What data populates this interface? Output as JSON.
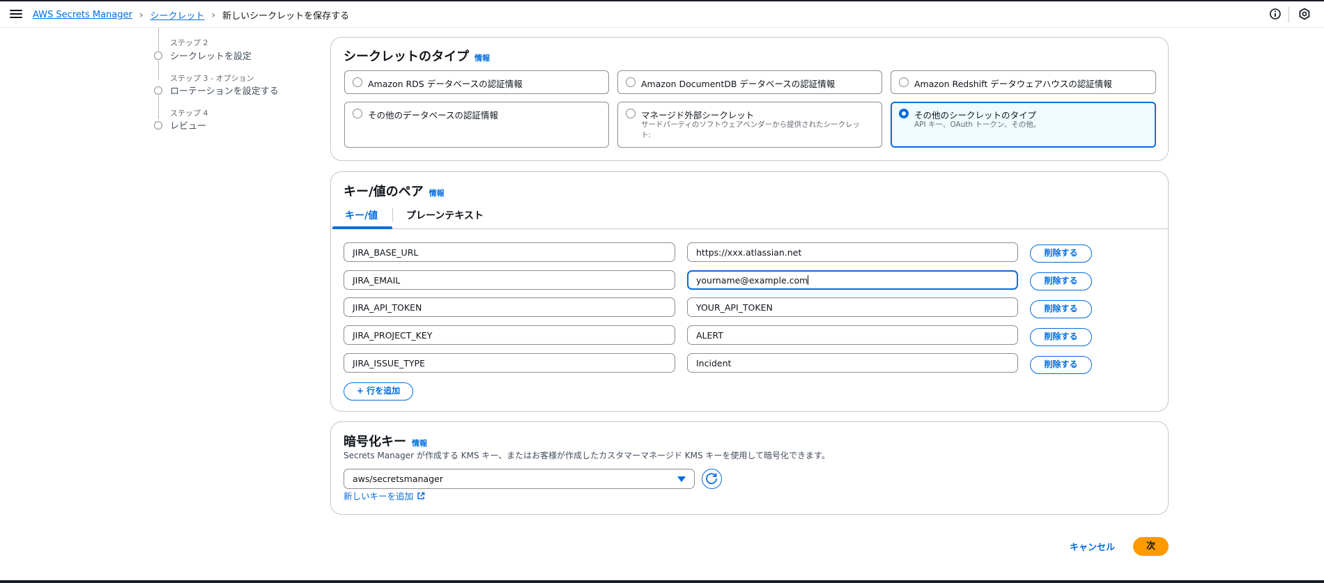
{
  "breadcrumb": {
    "service": "AWS Secrets Manager",
    "secrets": "シークレット",
    "current": "新しいシークレットを保存する"
  },
  "steps": [
    {
      "sub": "ステップ 2",
      "title": "シークレットを設定"
    },
    {
      "sub": "ステップ 3 - オプション",
      "title": "ローテーションを設定する"
    },
    {
      "sub": "ステップ 4",
      "title": "レビュー"
    }
  ],
  "secret_type": {
    "title": "シークレットのタイプ",
    "info": "情報",
    "options": [
      {
        "label": "Amazon RDS データベースの認証情報",
        "selected": false
      },
      {
        "label": "Amazon DocumentDB データベースの認証情報",
        "selected": false
      },
      {
        "label": "Amazon Redshift データウェアハウスの認証情報",
        "selected": false
      },
      {
        "label": "その他のデータベースの認証情報",
        "selected": false
      },
      {
        "label": "マネージド外部シークレット",
        "description": "サードパーティのソフトウェアベンダーから提供されたシークレット:",
        "selected": false
      },
      {
        "label": "その他のシークレットのタイプ",
        "description": "API キー、OAuth トークン、その他。",
        "selected": true
      }
    ]
  },
  "kv": {
    "title": "キー/値のペア",
    "info": "情報",
    "tabs": [
      "キー/値",
      "プレーンテキスト"
    ],
    "active_tab": "キー/値",
    "rows": [
      {
        "key": "JIRA_BASE_URL",
        "value": "https://xxx.atlassian.net"
      },
      {
        "key": "JIRA_EMAIL",
        "value": "yourname@example.com"
      },
      {
        "key": "JIRA_API_TOKEN",
        "value": "YOUR_API_TOKEN"
      },
      {
        "key": "JIRA_PROJECT_KEY",
        "value": "ALERT"
      },
      {
        "key": "JIRA_ISSUE_TYPE",
        "value": "Incident"
      }
    ],
    "remove_label": "削除する",
    "add_row_label": "+ 行を追加"
  },
  "encryption": {
    "title": "暗号化キー",
    "info": "情報",
    "description": "Secrets Manager が作成する KMS キー、またはお客様が作成したカスタマーマネージド KMS キーを使用して暗号化できます。",
    "selected_key": "aws/secretsmanager",
    "add_key_label": "新しいキーを追加"
  },
  "footer": {
    "cancel": "キャンセル",
    "next": "次"
  },
  "colors": {
    "accent": "#006ce0",
    "primary_button": "#ff9900",
    "selected_tile_bg": "#f0fbff"
  }
}
